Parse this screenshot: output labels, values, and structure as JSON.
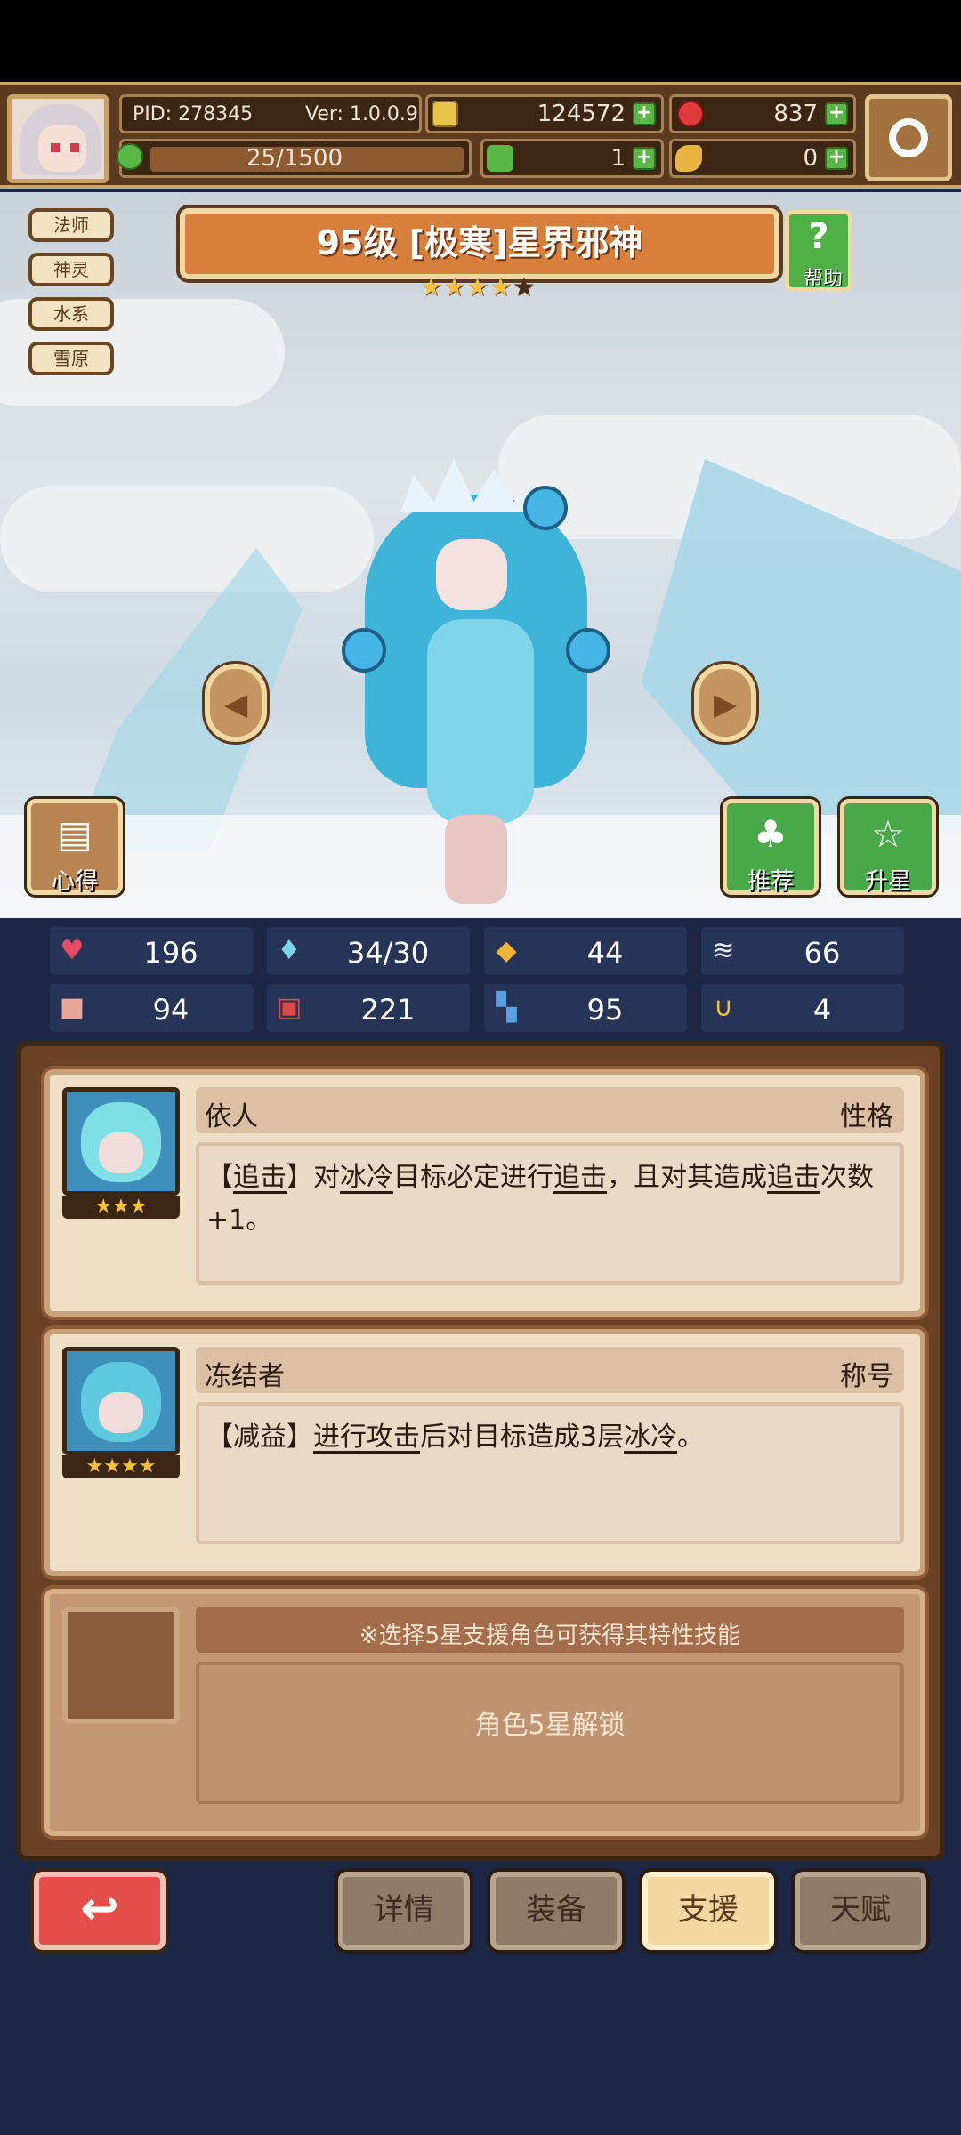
{
  "header": {
    "pid": "PID: 278345",
    "version": "Ver: 1.0.0.9",
    "gold": "124572",
    "gems": "837",
    "exp": "25/1500",
    "clover": "1",
    "key": "0"
  },
  "tags": [
    "法师",
    "神灵",
    "水系",
    "雪原"
  ],
  "hero": {
    "title": "95级 [极寒]星界邪神",
    "stars_filled": 4,
    "stars_total": 5,
    "help_label": "帮助"
  },
  "side_buttons": {
    "notes": "心得",
    "recommend": "推荐",
    "upgrade": "升星"
  },
  "stats": [
    {
      "icon": "heart-icon",
      "value": "196"
    },
    {
      "icon": "water-drop-icon",
      "value": "34/30"
    },
    {
      "icon": "shield-icon",
      "value": "44"
    },
    {
      "icon": "wing-icon",
      "value": "66"
    },
    {
      "icon": "fist-icon",
      "value": "94"
    },
    {
      "icon": "book-icon",
      "value": "221"
    },
    {
      "icon": "boot-icon",
      "value": "95"
    },
    {
      "icon": "horseshoe-icon",
      "value": "4"
    }
  ],
  "support": [
    {
      "name": "依人",
      "type": "性格",
      "stars": "★★★",
      "desc": {
        "p1": "【",
        "u1": "追击",
        "p2": "】对",
        "u2": "冰冷",
        "p3": "目标必定进行",
        "u3": "追击",
        "p4": "，且对其造成",
        "u4": "追击",
        "p5": "次数+1。"
      }
    },
    {
      "name": "冻结者",
      "type": "称号",
      "stars": "★★★★",
      "desc": {
        "p1": "【减益】",
        "u1": "进行攻击",
        "p2": "后对目标造成3层",
        "u2": "冰冷",
        "p3": "。"
      }
    }
  ],
  "locked": {
    "hint": "※选择5星支援角色可获得其特性技能",
    "text": "角色5星解锁"
  },
  "nav": {
    "back": "↩",
    "tabs": [
      "详情",
      "装备",
      "支援",
      "天赋"
    ],
    "active_tab": "支援"
  },
  "colors": {
    "accent": "#d97f3c",
    "panel": "#6b4126",
    "background": "#1b2744",
    "plus": "#59b845"
  }
}
